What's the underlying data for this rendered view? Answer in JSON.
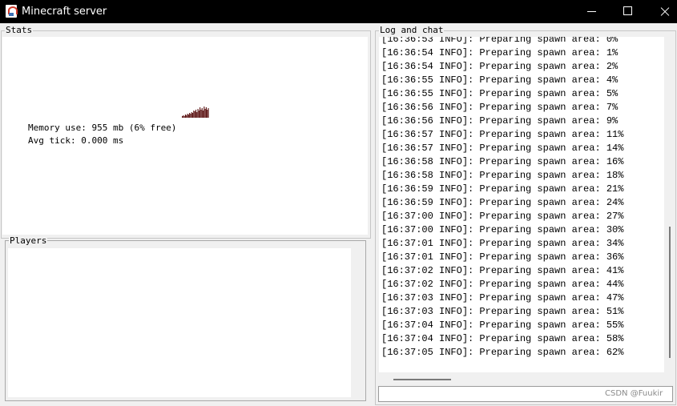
{
  "window": {
    "title": "Minecraft server",
    "icon": "java-cup-icon"
  },
  "stats": {
    "legend": "Stats",
    "memory": "Memory use: 955 mb (6% free)",
    "avg_tick": "Avg tick: 0.000 ms",
    "graph_color": "#5a1010"
  },
  "players": {
    "legend": "Players"
  },
  "log": {
    "legend": "Log and chat",
    "lines": [
      "[16:36:53 INFO]: Preparing spawn area: 0%",
      "[16:36:54 INFO]: Preparing spawn area: 1%",
      "[16:36:54 INFO]: Preparing spawn area: 2%",
      "[16:36:55 INFO]: Preparing spawn area: 4%",
      "[16:36:55 INFO]: Preparing spawn area: 5%",
      "[16:36:56 INFO]: Preparing spawn area: 7%",
      "[16:36:56 INFO]: Preparing spawn area: 9%",
      "[16:36:57 INFO]: Preparing spawn area: 11%",
      "[16:36:57 INFO]: Preparing spawn area: 14%",
      "[16:36:58 INFO]: Preparing spawn area: 16%",
      "[16:36:58 INFO]: Preparing spawn area: 18%",
      "[16:36:59 INFO]: Preparing spawn area: 21%",
      "[16:36:59 INFO]: Preparing spawn area: 24%",
      "[16:37:00 INFO]: Preparing spawn area: 27%",
      "[16:37:00 INFO]: Preparing spawn area: 30%",
      "[16:37:01 INFO]: Preparing spawn area: 34%",
      "[16:37:01 INFO]: Preparing spawn area: 36%",
      "[16:37:02 INFO]: Preparing spawn area: 41%",
      "[16:37:02 INFO]: Preparing spawn area: 44%",
      "[16:37:03 INFO]: Preparing spawn area: 47%",
      "[16:37:03 INFO]: Preparing spawn area: 51%",
      "[16:37:04 INFO]: Preparing spawn area: 55%",
      "[16:37:04 INFO]: Preparing spawn area: 58%",
      "[16:37:05 INFO]: Preparing spawn area: 62%"
    ]
  },
  "chat_input": {
    "value": ""
  },
  "watermark": "CSDN @Fuukir"
}
